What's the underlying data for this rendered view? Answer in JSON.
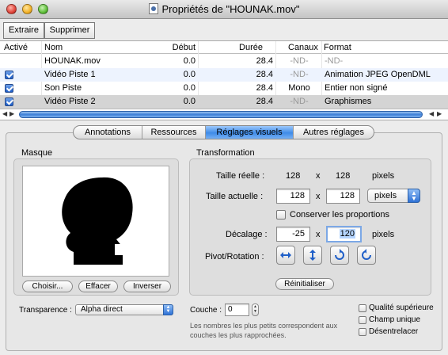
{
  "window": {
    "title": "Propriétés de \"HOUNAK.mov\""
  },
  "toolbar": {
    "extract_label": "Extraire",
    "delete_label": "Supprimer"
  },
  "table": {
    "headers": {
      "active": "Activé",
      "name": "Nom",
      "start": "Début",
      "duration": "Durée",
      "channels": "Canaux",
      "format": "Format"
    },
    "rows": [
      {
        "checked": false,
        "name": "HOUNAK.mov",
        "start": "0.0",
        "duration": "28.4",
        "channels": "-ND-",
        "format": "-ND-"
      },
      {
        "checked": true,
        "name": "Vidéo Piste 1",
        "start": "0.0",
        "duration": "28.4",
        "channels": "-ND-",
        "format": "Animation JPEG OpenDML"
      },
      {
        "checked": true,
        "name": "Son Piste",
        "start": "0.0",
        "duration": "28.4",
        "channels": "Mono",
        "format": "Entier non signé"
      },
      {
        "checked": true,
        "name": "Vidéo Piste 2",
        "start": "0.0",
        "duration": "28.4",
        "channels": "-ND-",
        "format": "Graphismes"
      }
    ]
  },
  "tabs": [
    {
      "label": "Annotations",
      "active": false
    },
    {
      "label": "Ressources",
      "active": false
    },
    {
      "label": "Réglages visuels",
      "active": true
    },
    {
      "label": "Autres réglages",
      "active": false
    }
  ],
  "mask": {
    "title": "Masque",
    "choose_label": "Choisir...",
    "clear_label": "Effacer",
    "invert_label": "Inverser"
  },
  "transform": {
    "title": "Transformation",
    "real_size_label": "Taille réelle :",
    "real_width": "128",
    "real_height": "128",
    "times": "x",
    "pixels": "pixels",
    "current_size_label": "Taille actuelle :",
    "current_width": "128",
    "current_height": "128",
    "unit_selected": "pixels",
    "keep_proportions_label": "Conserver les proportions",
    "offset_label": "Décalage :",
    "offset_x": "-25",
    "offset_y": "120",
    "pivot_label": "Pivot/Rotation :",
    "reset_label": "Réinitialiser"
  },
  "bottom": {
    "transparency_label": "Transparence :",
    "transparency_value": "Alpha direct",
    "layer_label": "Couche :",
    "layer_value": "0",
    "layer_hint_line1": "Les nombres les plus petits correspondent aux",
    "layer_hint_line2": "couches les plus rapprochées.",
    "high_quality_label": "Qualité supérieure",
    "single_field_label": "Champ unique",
    "deinterlace_label": "Désentrelacer"
  }
}
